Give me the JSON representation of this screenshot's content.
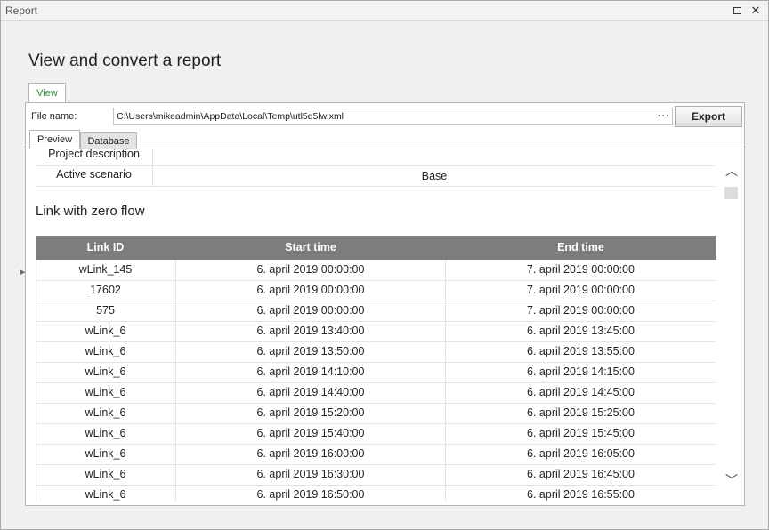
{
  "window": {
    "title": "Report"
  },
  "page": {
    "heading": "View and convert a report"
  },
  "outer_tab": {
    "label": "View"
  },
  "file": {
    "label": "File name:",
    "value": "C:\\Users\\mikeadmin\\AppData\\Local\\Temp\\utl5q5lw.xml",
    "browse_label": "···"
  },
  "export_label": "Export",
  "tabs": [
    {
      "label": "Preview",
      "active": true
    },
    {
      "label": "Database",
      "active": false
    }
  ],
  "info_rows": [
    {
      "label": "Project description",
      "value": ""
    },
    {
      "label": "Active scenario",
      "value": "Base"
    }
  ],
  "section_title": "Link with zero flow",
  "table": {
    "headers": [
      "Link ID",
      "Start time",
      "End time"
    ],
    "rows": [
      [
        "wLink_145",
        "6. april 2019 00:00:00",
        "7. april 2019 00:00:00"
      ],
      [
        "17602",
        "6. april 2019 00:00:00",
        "7. april 2019 00:00:00"
      ],
      [
        "575",
        "6. april 2019 00:00:00",
        "7. april 2019 00:00:00"
      ],
      [
        "wLink_6",
        "6. april 2019 13:40:00",
        "6. april 2019 13:45:00"
      ],
      [
        "wLink_6",
        "6. april 2019 13:50:00",
        "6. april 2019 13:55:00"
      ],
      [
        "wLink_6",
        "6. april 2019 14:10:00",
        "6. april 2019 14:15:00"
      ],
      [
        "wLink_6",
        "6. april 2019 14:40:00",
        "6. april 2019 14:45:00"
      ],
      [
        "wLink_6",
        "6. april 2019 15:20:00",
        "6. april 2019 15:25:00"
      ],
      [
        "wLink_6",
        "6. april 2019 15:40:00",
        "6. april 2019 15:45:00"
      ],
      [
        "wLink_6",
        "6. april 2019 16:00:00",
        "6. april 2019 16:05:00"
      ],
      [
        "wLink_6",
        "6. april 2019 16:30:00",
        "6. april 2019 16:45:00"
      ],
      [
        "wLink_6",
        "6. april 2019 16:50:00",
        "6. april 2019 16:55:00"
      ]
    ]
  },
  "icons": {
    "restore": "restore-icon",
    "close": "close-icon",
    "scroll_up": "chevron-up-icon",
    "scroll_down": "chevron-down-icon",
    "side": "triangle-right-icon"
  },
  "colors": {
    "header_bg": "#7d7d7d",
    "active_tab_text": "#2e8b3a"
  }
}
